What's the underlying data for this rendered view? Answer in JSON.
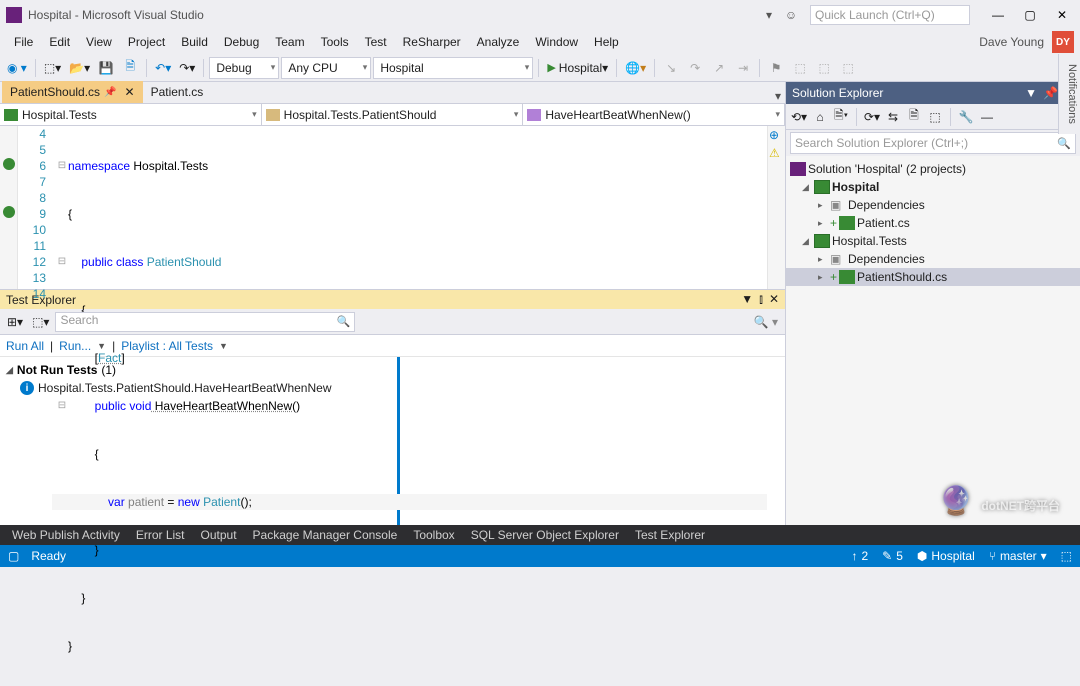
{
  "window": {
    "title": "Hospital - Microsoft Visual Studio",
    "quick_launch": "Quick Launch (Ctrl+Q)",
    "user": "Dave Young",
    "user_initials": "DY"
  },
  "menu": [
    "File",
    "Edit",
    "View",
    "Project",
    "Build",
    "Debug",
    "Team",
    "Tools",
    "Test",
    "ReSharper",
    "Analyze",
    "Window",
    "Help"
  ],
  "toolbar": {
    "config": "Debug",
    "platform": "Any CPU",
    "startup": "Hospital",
    "run_label": "Hospital"
  },
  "tabs": {
    "active": "PatientShould.cs",
    "inactive": "Patient.cs"
  },
  "nav": {
    "project": "Hospital.Tests",
    "class": "Hospital.Tests.PatientShould",
    "method": "HaveHeartBeatWhenNew()"
  },
  "code": {
    "line_start": 4,
    "namespace_kw": "namespace",
    "namespace": " Hospital.Tests",
    "public_kw": "public",
    "class_kw": "class",
    "class_name": " PatientShould",
    "fact": "Fact",
    "void_kw": "void",
    "method_name": " HaveHeartBeatWhenNew",
    "var_kw": "var",
    "var_name": " patient ",
    "new_kw": "new",
    "type_name": " Patient"
  },
  "solution_explorer": {
    "title": "Solution Explorer",
    "search": "Search Solution Explorer (Ctrl+;)",
    "root": "Solution 'Hospital' (2 projects)",
    "proj1": "Hospital",
    "deps": "Dependencies",
    "file1": "Patient.cs",
    "proj2": "Hospital.Tests",
    "file2": "PatientShould.cs"
  },
  "notifications_tab": "Notifications",
  "test_explorer": {
    "title": "Test Explorer",
    "search": "Search",
    "run_all": "Run All",
    "run": "Run...",
    "playlist": "Playlist : All Tests",
    "group": "Not Run Tests",
    "group_count": " (1)",
    "test1": "Hospital.Tests.PatientShould.HaveHeartBeatWhenNew"
  },
  "bottom_tabs": [
    "Web Publish Activity",
    "Error List",
    "Output",
    "Package Manager Console",
    "Toolbox",
    "SQL Server Object Explorer",
    "Test Explorer"
  ],
  "statusbar": {
    "ready": "Ready",
    "up": "2",
    "pencil": "5",
    "repo": "Hospital",
    "branch": "master"
  },
  "watermark": "dotNET跨平台"
}
